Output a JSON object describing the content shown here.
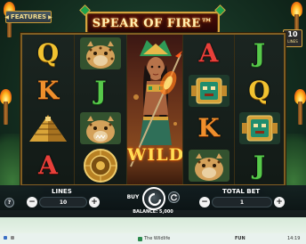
{
  "game": {
    "title": "SPEAR OF FIRE™",
    "features_label": "FEATURES",
    "lines_badge": {
      "number": "10",
      "label": "LINES"
    },
    "wild_label": "WILD"
  },
  "reels": [
    [
      "Q",
      "K",
      "pyramid",
      "A"
    ],
    [
      "jaguar",
      "J",
      "jaguar",
      "aztec-calendar"
    ],
    [
      "A",
      "mask",
      "K",
      "jaguar"
    ],
    [
      "J",
      "Q",
      "mask",
      "J"
    ]
  ],
  "controls": {
    "lines_label": "LINES",
    "lines_value": "10",
    "buy_label": "BUY",
    "total_bet_label": "TOTAL BET",
    "total_bet_value": "1",
    "balance_label": "BALANCE: 5,000",
    "help_label": "?",
    "minus_label": "−",
    "plus_label": "+"
  },
  "taskbar": {
    "tab_label": "The Wildlife",
    "mode_label": "FUN",
    "time": "14:19"
  },
  "colors": {
    "gold": "#d6a23d",
    "letter_q": "#f1c230",
    "letter_k": "#ef8f2c",
    "letter_a": "#e8403a",
    "letter_j": "#57c94a"
  }
}
